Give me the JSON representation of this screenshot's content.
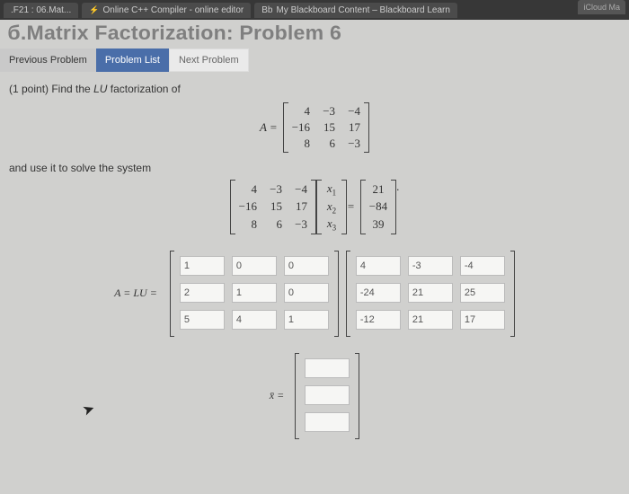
{
  "tabs": {
    "t0": ".F21 : 06.Mat...",
    "t1": "Online C++ Compiler - online editor",
    "t2": "My Blackboard Content – Blackboard Learn",
    "t3": "iCloud Ma"
  },
  "title": "б.Matrix Factorization: Problem 6",
  "nav": {
    "prev": "Previous Problem",
    "list": "Problem List",
    "next": "Next Problem"
  },
  "prompt": {
    "lead": "(1 point) Find the ",
    "LU": "LU",
    "tail": " factorization of"
  },
  "sub": "and use it to solve the system",
  "labels": {
    "A": "A =",
    "ALU": "A = LU =",
    "x": "x̄ =",
    "eq": "="
  },
  "A": {
    "r0": {
      "c0": "4",
      "c1": "−3",
      "c2": "−4"
    },
    "r1": {
      "c0": "−16",
      "c1": "15",
      "c2": "17"
    },
    "r2": {
      "c0": "8",
      "c1": "6",
      "c2": "−3"
    }
  },
  "xv": {
    "r0": "x",
    "r1": "x",
    "r2": "x",
    "s0": "1",
    "s1": "2",
    "s2": "3"
  },
  "b": {
    "r0": "21",
    "r1": "−84",
    "r2": "39"
  },
  "L": {
    "r0": {
      "c0": "1",
      "c1": "0",
      "c2": "0"
    },
    "r1": {
      "c0": "2",
      "c1": "1",
      "c2": "0"
    },
    "r2": {
      "c0": "5",
      "c1": "4",
      "c2": "1"
    }
  },
  "U": {
    "r0": {
      "c0": "4",
      "c1": "-3",
      "c2": "-4"
    },
    "r1": {
      "c0": "-24",
      "c1": "21",
      "c2": "25"
    },
    "r2": {
      "c0": "-12",
      "c1": "21",
      "c2": "17"
    }
  }
}
